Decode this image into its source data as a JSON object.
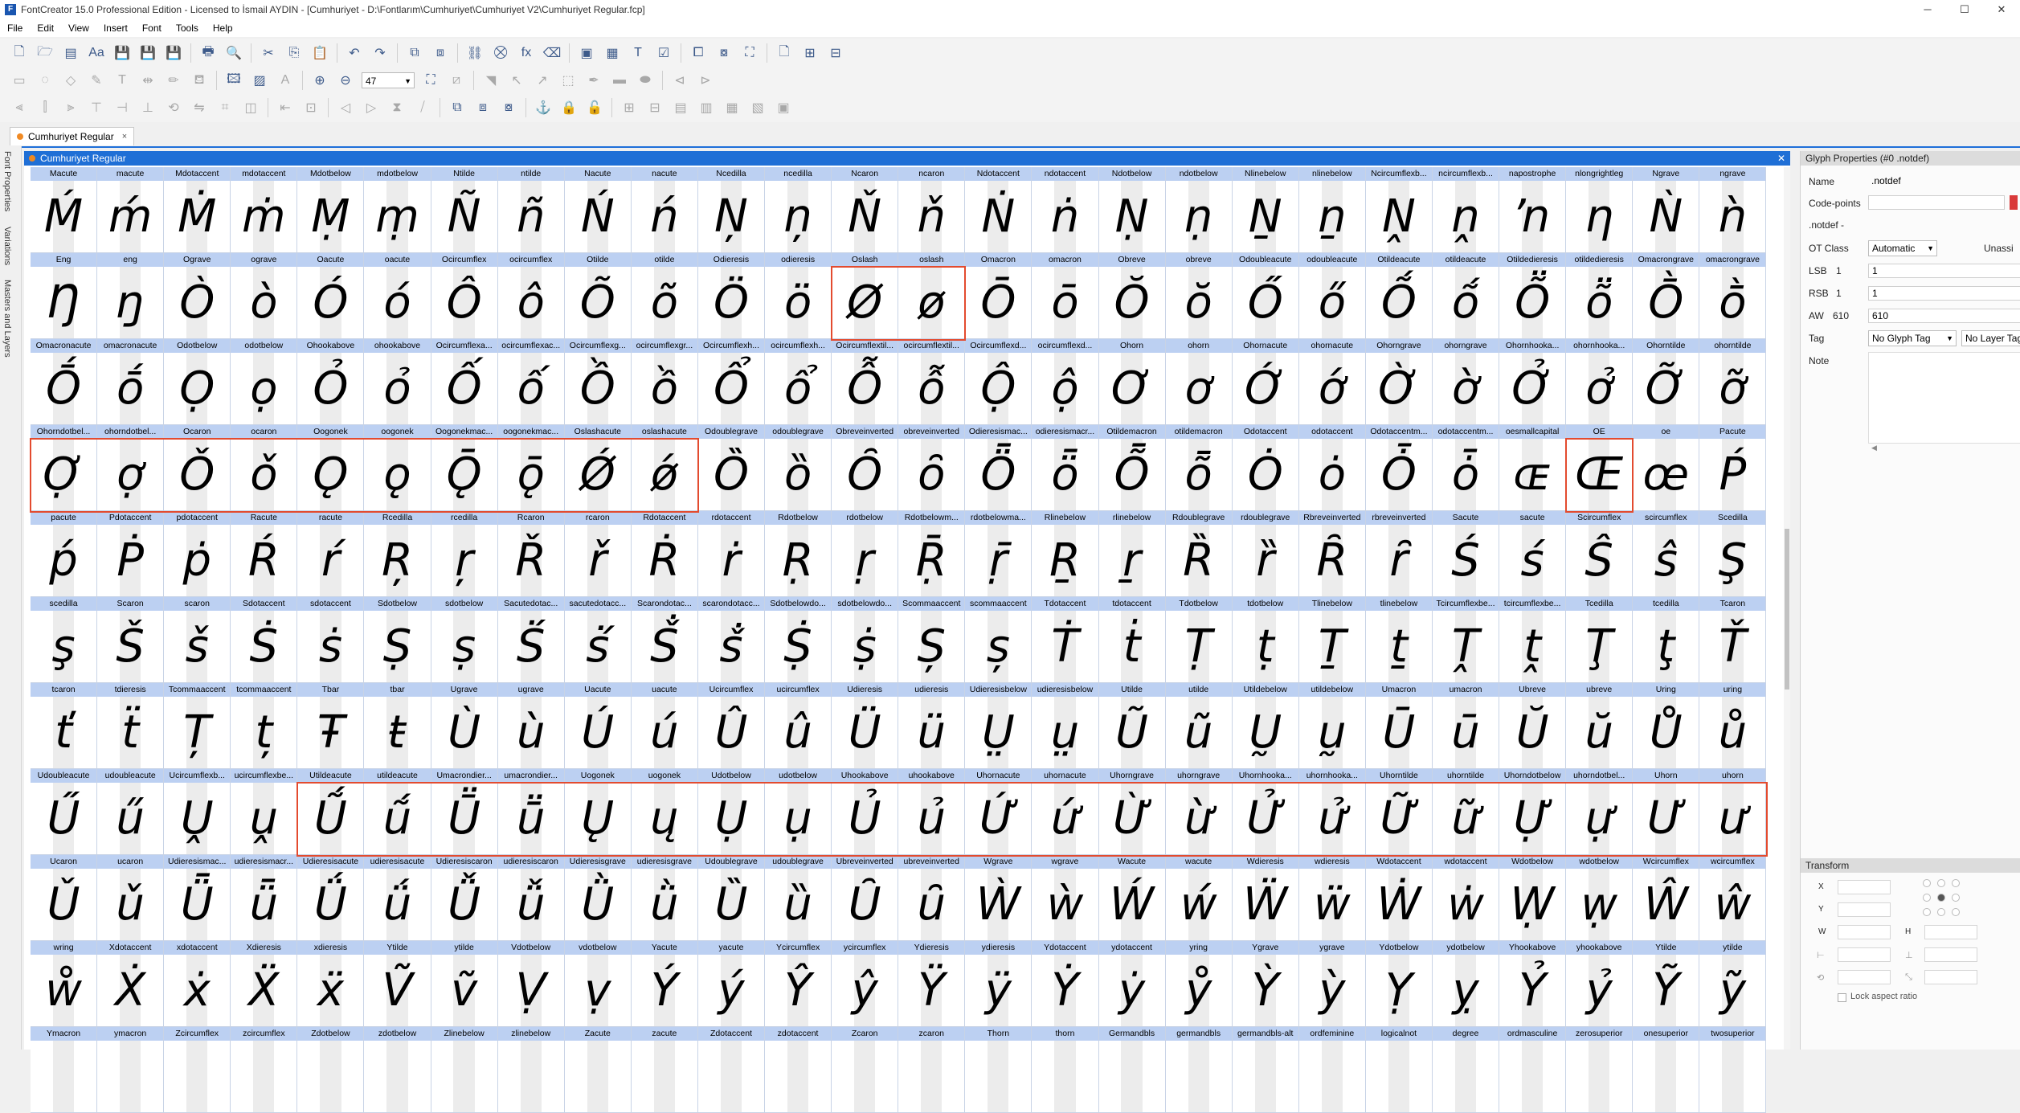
{
  "window": {
    "title": "FontCreator 15.0 Professional Edition - Licensed to İsmail AYDIN - [Cumhuriyet - D:\\Fontlarım\\Cumhuriyet\\Cumhuriyet V2\\Cumhuriyet Regular.fcp]",
    "app_icon_letter": "F",
    "minimize": "─",
    "maximize": "☐",
    "close": "✕"
  },
  "menu": [
    "File",
    "Edit",
    "View",
    "Insert",
    "Font",
    "Tools",
    "Help"
  ],
  "toolbar": {
    "zoom_value": "47"
  },
  "tab": {
    "label": "Cumhuriyet Regular",
    "close": "×"
  },
  "sidebar_tabs": [
    "Font Properties",
    "Variations",
    "Masters and Layers"
  ],
  "font_window": {
    "title": "Cumhuriyet Regular",
    "close": "✕"
  },
  "glyph_rows": [
    [
      [
        "Macute",
        "Ḿ"
      ],
      [
        "macute",
        "ḿ"
      ],
      [
        "Mdotaccent",
        "Ṁ"
      ],
      [
        "mdotaccent",
        "ṁ"
      ],
      [
        "Mdotbelow",
        "Ṃ"
      ],
      [
        "mdotbelow",
        "ṃ"
      ],
      [
        "Ntilde",
        "Ñ"
      ],
      [
        "ntilde",
        "ñ"
      ],
      [
        "Nacute",
        "Ń"
      ],
      [
        "nacute",
        "ń"
      ],
      [
        "Ncedilla",
        "Ņ"
      ],
      [
        "ncedilla",
        "ņ"
      ],
      [
        "Ncaron",
        "Ň"
      ],
      [
        "ncaron",
        "ň"
      ],
      [
        "Ndotaccent",
        "Ṅ"
      ],
      [
        "ndotaccent",
        "ṅ"
      ],
      [
        "Ndotbelow",
        "Ṇ"
      ],
      [
        "ndotbelow",
        "ṇ"
      ],
      [
        "Nlinebelow",
        "Ṉ"
      ],
      [
        "nlinebelow",
        "ṉ"
      ],
      [
        "Ncircumflexb...",
        "Ṋ"
      ],
      [
        "ncircumflexb...",
        "ṋ"
      ],
      [
        "napostrophe",
        "ŉ"
      ],
      [
        "nlongrightleg",
        "ƞ"
      ],
      [
        "Ngrave",
        "Ǹ"
      ],
      [
        "ngrave",
        "ǹ"
      ]
    ],
    [
      [
        "Eng",
        "Ŋ"
      ],
      [
        "eng",
        "ŋ"
      ],
      [
        "Ograve",
        "Ò"
      ],
      [
        "ograve",
        "ò"
      ],
      [
        "Oacute",
        "Ó"
      ],
      [
        "oacute",
        "ó"
      ],
      [
        "Ocircumflex",
        "Ô"
      ],
      [
        "ocircumflex",
        "ô"
      ],
      [
        "Otilde",
        "Õ"
      ],
      [
        "otilde",
        "õ"
      ],
      [
        "Odieresis",
        "Ö"
      ],
      [
        "odieresis",
        "ö"
      ],
      [
        "Oslash",
        "Ø"
      ],
      [
        "oslash",
        "ø"
      ],
      [
        "Omacron",
        "Ō"
      ],
      [
        "omacron",
        "ō"
      ],
      [
        "Obreve",
        "Ŏ"
      ],
      [
        "obreve",
        "ŏ"
      ],
      [
        "Odoubleacute",
        "Ő"
      ],
      [
        "odoubleacute",
        "ő"
      ],
      [
        "Otildeacute",
        "Ṍ"
      ],
      [
        "otildeacute",
        "ṍ"
      ],
      [
        "Otildedieresis",
        "Ṏ"
      ],
      [
        "otildedieresis",
        "ṏ"
      ],
      [
        "Omacrongrave",
        "Ṑ"
      ],
      [
        "omacrongrave",
        "ṑ"
      ]
    ],
    [
      [
        "Omacronacute",
        "Ṓ"
      ],
      [
        "omacronacute",
        "ṓ"
      ],
      [
        "Odotbelow",
        "Ọ"
      ],
      [
        "odotbelow",
        "ọ"
      ],
      [
        "Ohookabove",
        "Ỏ"
      ],
      [
        "ohookabove",
        "ỏ"
      ],
      [
        "Ocircumflexa...",
        "Ố"
      ],
      [
        "ocircumflexac...",
        "ố"
      ],
      [
        "Ocircumflexg...",
        "Ồ"
      ],
      [
        "ocircumflexgr...",
        "ồ"
      ],
      [
        "Ocircumflexh...",
        "Ổ"
      ],
      [
        "ocircumflexh...",
        "ổ"
      ],
      [
        "Ocircumflextil...",
        "Ỗ"
      ],
      [
        "ocircumflextil...",
        "ỗ"
      ],
      [
        "Ocircumflexd...",
        "Ộ"
      ],
      [
        "ocircumflexd...",
        "ộ"
      ],
      [
        "Ohorn",
        "Ơ"
      ],
      [
        "ohorn",
        "ơ"
      ],
      [
        "Ohornacute",
        "Ớ"
      ],
      [
        "ohornacute",
        "ớ"
      ],
      [
        "Ohorngrave",
        "Ờ"
      ],
      [
        "ohorngrave",
        "ờ"
      ],
      [
        "Ohornhooka...",
        "Ở"
      ],
      [
        "ohornhooka...",
        "ở"
      ],
      [
        "Ohorntilde",
        "Ỡ"
      ],
      [
        "ohorntilde",
        "ỡ"
      ]
    ],
    [
      [
        "Ohorndotbel...",
        "Ợ"
      ],
      [
        "ohorndotbel...",
        "ợ"
      ],
      [
        "Ocaron",
        "Ǒ"
      ],
      [
        "ocaron",
        "ǒ"
      ],
      [
        "Oogonek",
        "Ǫ"
      ],
      [
        "oogonek",
        "ǫ"
      ],
      [
        "Oogonekmac...",
        "Ǭ"
      ],
      [
        "oogonekmac...",
        "ǭ"
      ],
      [
        "Oslashacute",
        "Ǿ"
      ],
      [
        "oslashacute",
        "ǿ"
      ],
      [
        "Odoublegrave",
        "Ȍ"
      ],
      [
        "odoublegrave",
        "ȍ"
      ],
      [
        "Obreveinverted",
        "Ȏ"
      ],
      [
        "obreveinverted",
        "ȏ"
      ],
      [
        "Odieresismac...",
        "Ȫ"
      ],
      [
        "odieresismacr...",
        "ȫ"
      ],
      [
        "Otildemacron",
        "Ȭ"
      ],
      [
        "otildemacron",
        "ȭ"
      ],
      [
        "Odotaccent",
        "Ȯ"
      ],
      [
        "odotaccent",
        "ȯ"
      ],
      [
        "Odotaccentm...",
        "Ȱ"
      ],
      [
        "odotaccentm...",
        "ȱ"
      ],
      [
        "oesmallcapital",
        "ɶ"
      ],
      [
        "OE",
        "Œ"
      ],
      [
        "oe",
        "œ"
      ],
      [
        "Pacute",
        "Ṕ"
      ]
    ],
    [
      [
        "pacute",
        "ṕ"
      ],
      [
        "Pdotaccent",
        "Ṗ"
      ],
      [
        "pdotaccent",
        "ṗ"
      ],
      [
        "Racute",
        "Ŕ"
      ],
      [
        "racute",
        "ŕ"
      ],
      [
        "Rcedilla",
        "Ŗ"
      ],
      [
        "rcedilla",
        "ŗ"
      ],
      [
        "Rcaron",
        "Ř"
      ],
      [
        "rcaron",
        "ř"
      ],
      [
        "Rdotaccent",
        "Ṙ"
      ],
      [
        "rdotaccent",
        "ṙ"
      ],
      [
        "Rdotbelow",
        "Ṛ"
      ],
      [
        "rdotbelow",
        "ṛ"
      ],
      [
        "Rdotbelowm...",
        "Ṝ"
      ],
      [
        "rdotbelowma...",
        "ṝ"
      ],
      [
        "Rlinebelow",
        "Ṟ"
      ],
      [
        "rlinebelow",
        "ṟ"
      ],
      [
        "Rdoublegrave",
        "Ȑ"
      ],
      [
        "rdoublegrave",
        "ȑ"
      ],
      [
        "Rbreveinverted",
        "Ȓ"
      ],
      [
        "rbreveinverted",
        "ȓ"
      ],
      [
        "Sacute",
        "Ś"
      ],
      [
        "sacute",
        "ś"
      ],
      [
        "Scircumflex",
        "Ŝ"
      ],
      [
        "scircumflex",
        "ŝ"
      ],
      [
        "Scedilla",
        "Ş"
      ]
    ],
    [
      [
        "scedilla",
        "ş"
      ],
      [
        "Scaron",
        "Š"
      ],
      [
        "scaron",
        "š"
      ],
      [
        "Sdotaccent",
        "Ṡ"
      ],
      [
        "sdotaccent",
        "ṡ"
      ],
      [
        "Sdotbelow",
        "Ṣ"
      ],
      [
        "sdotbelow",
        "ṣ"
      ],
      [
        "Sacutedotac...",
        "Ṥ"
      ],
      [
        "sacutedotacc...",
        "ṥ"
      ],
      [
        "Scarondotac...",
        "Ṧ"
      ],
      [
        "scarondotacc...",
        "ṧ"
      ],
      [
        "Sdotbelowdo...",
        "Ṩ"
      ],
      [
        "sdotbelowdo...",
        "ṩ"
      ],
      [
        "Scommaaccent",
        "Ș"
      ],
      [
        "scommaaccent",
        "ș"
      ],
      [
        "Tdotaccent",
        "Ṫ"
      ],
      [
        "tdotaccent",
        "ṫ"
      ],
      [
        "Tdotbelow",
        "Ṭ"
      ],
      [
        "tdotbelow",
        "ṭ"
      ],
      [
        "Tlinebelow",
        "Ṯ"
      ],
      [
        "tlinebelow",
        "ṯ"
      ],
      [
        "Tcircumflexbe...",
        "Ṱ"
      ],
      [
        "tcircumflexbe...",
        "ṱ"
      ],
      [
        "Tcedilla",
        "Ţ"
      ],
      [
        "tcedilla",
        "ţ"
      ],
      [
        "Tcaron",
        "Ť"
      ]
    ],
    [
      [
        "tcaron",
        "ť"
      ],
      [
        "tdieresis",
        "ẗ"
      ],
      [
        "Tcommaaccent",
        "Ț"
      ],
      [
        "tcommaaccent",
        "ț"
      ],
      [
        "Tbar",
        "Ŧ"
      ],
      [
        "tbar",
        "ŧ"
      ],
      [
        "Ugrave",
        "Ù"
      ],
      [
        "ugrave",
        "ù"
      ],
      [
        "Uacute",
        "Ú"
      ],
      [
        "uacute",
        "ú"
      ],
      [
        "Ucircumflex",
        "Û"
      ],
      [
        "ucircumflex",
        "û"
      ],
      [
        "Udieresis",
        "Ü"
      ],
      [
        "udieresis",
        "ü"
      ],
      [
        "Udieresisbelow",
        "Ṳ"
      ],
      [
        "udieresisbelow",
        "ṳ"
      ],
      [
        "Utilde",
        "Ũ"
      ],
      [
        "utilde",
        "ũ"
      ],
      [
        "Utildebelow",
        "Ṵ"
      ],
      [
        "utildebelow",
        "ṵ"
      ],
      [
        "Umacron",
        "Ū"
      ],
      [
        "umacron",
        "ū"
      ],
      [
        "Ubreve",
        "Ŭ"
      ],
      [
        "ubreve",
        "ŭ"
      ],
      [
        "Uring",
        "Ů"
      ],
      [
        "uring",
        "ů"
      ]
    ],
    [
      [
        "Udoubleacute",
        "Ű"
      ],
      [
        "udoubleacute",
        "ű"
      ],
      [
        "Ucircumflexb...",
        "Ṷ"
      ],
      [
        "ucircumflexbe...",
        "ṷ"
      ],
      [
        "Utildeacute",
        "Ṹ"
      ],
      [
        "utildeacute",
        "ṹ"
      ],
      [
        "Umacrondier...",
        "Ṻ"
      ],
      [
        "umacrondier...",
        "ṻ"
      ],
      [
        "Uogonek",
        "Ų"
      ],
      [
        "uogonek",
        "ų"
      ],
      [
        "Udotbelow",
        "Ụ"
      ],
      [
        "udotbelow",
        "ụ"
      ],
      [
        "Uhookabove",
        "Ủ"
      ],
      [
        "uhookabove",
        "ủ"
      ],
      [
        "Uhornacute",
        "Ứ"
      ],
      [
        "uhornacute",
        "ứ"
      ],
      [
        "Uhorngrave",
        "Ừ"
      ],
      [
        "uhorngrave",
        "ừ"
      ],
      [
        "Uhornhooka...",
        "Ử"
      ],
      [
        "uhornhooka...",
        "ử"
      ],
      [
        "Uhorntilde",
        "Ữ"
      ],
      [
        "uhorntilde",
        "ữ"
      ],
      [
        "Uhorndotbelow",
        "Ự"
      ],
      [
        "uhorndotbel...",
        "ự"
      ],
      [
        "Uhorn",
        "Ư"
      ],
      [
        "uhorn",
        "ư"
      ]
    ],
    [
      [
        "Ucaron",
        "Ǔ"
      ],
      [
        "ucaron",
        "ǔ"
      ],
      [
        "Udieresismac...",
        "Ǖ"
      ],
      [
        "udieresismacr...",
        "ǖ"
      ],
      [
        "Udieresisacute",
        "Ǘ"
      ],
      [
        "udieresisacute",
        "ǘ"
      ],
      [
        "Udieresiscaron",
        "Ǚ"
      ],
      [
        "udieresiscaron",
        "ǚ"
      ],
      [
        "Udieresisgrave",
        "Ǜ"
      ],
      [
        "udieresisgrave",
        "ǜ"
      ],
      [
        "Udoublegrave",
        "Ȕ"
      ],
      [
        "udoublegrave",
        "ȕ"
      ],
      [
        "Ubreveinverted",
        "Ȗ"
      ],
      [
        "ubreveinverted",
        "ȗ"
      ],
      [
        "Wgrave",
        "Ẁ"
      ],
      [
        "wgrave",
        "ẁ"
      ],
      [
        "Wacute",
        "Ẃ"
      ],
      [
        "wacute",
        "ẃ"
      ],
      [
        "Wdieresis",
        "Ẅ"
      ],
      [
        "wdieresis",
        "ẅ"
      ],
      [
        "Wdotaccent",
        "Ẇ"
      ],
      [
        "wdotaccent",
        "ẇ"
      ],
      [
        "Wdotbelow",
        "Ẉ"
      ],
      [
        "wdotbelow",
        "ẉ"
      ],
      [
        "Wcircumflex",
        "Ŵ"
      ],
      [
        "wcircumflex",
        "ŵ"
      ]
    ],
    [
      [
        "wring",
        "ẘ"
      ],
      [
        "Xdotaccent",
        "Ẋ"
      ],
      [
        "xdotaccent",
        "ẋ"
      ],
      [
        "Xdieresis",
        "Ẍ"
      ],
      [
        "xdieresis",
        "ẍ"
      ],
      [
        "Ytilde",
        "Ṽ"
      ],
      [
        "ytilde",
        "ṽ"
      ],
      [
        "Vdotbelow",
        "Ṿ"
      ],
      [
        "vdotbelow",
        "ṿ"
      ],
      [
        "Yacute",
        "Ý"
      ],
      [
        "yacute",
        "ý"
      ],
      [
        "Ycircumflex",
        "Ŷ"
      ],
      [
        "ycircumflex",
        "ŷ"
      ],
      [
        "Ydieresis",
        "Ÿ"
      ],
      [
        "ydieresis",
        "ÿ"
      ],
      [
        "Ydotaccent",
        "Ẏ"
      ],
      [
        "ydotaccent",
        "ẏ"
      ],
      [
        "yring",
        "ẙ"
      ],
      [
        "Ygrave",
        "Ỳ"
      ],
      [
        "ygrave",
        "ỳ"
      ],
      [
        "Ydotbelow",
        "Ỵ"
      ],
      [
        "ydotbelow",
        "ỵ"
      ],
      [
        "Yhookabove",
        "Ỷ"
      ],
      [
        "yhookabove",
        "ỷ"
      ],
      [
        "Ytilde",
        "Ỹ"
      ],
      [
        "ytilde",
        "ỹ"
      ]
    ],
    [
      [
        "Ymacron",
        ""
      ],
      [
        "ymacron",
        ""
      ],
      [
        "Zcircumflex",
        ""
      ],
      [
        "zcircumflex",
        ""
      ],
      [
        "Zdotbelow",
        ""
      ],
      [
        "zdotbelow",
        ""
      ],
      [
        "Zlinebelow",
        ""
      ],
      [
        "zlinebelow",
        ""
      ],
      [
        "Zacute",
        ""
      ],
      [
        "zacute",
        ""
      ],
      [
        "Zdotaccent",
        ""
      ],
      [
        "zdotaccent",
        ""
      ],
      [
        "Zcaron",
        ""
      ],
      [
        "zcaron",
        ""
      ],
      [
        "Thorn",
        ""
      ],
      [
        "thorn",
        ""
      ],
      [
        "Germandbls",
        ""
      ],
      [
        "germandbls",
        ""
      ],
      [
        "germandbls-alt",
        ""
      ],
      [
        "ordfeminine",
        ""
      ],
      [
        "logicalnot",
        ""
      ],
      [
        "degree",
        ""
      ],
      [
        "ordmasculine",
        ""
      ],
      [
        "zerosuperior",
        ""
      ],
      [
        "onesuperior",
        ""
      ],
      [
        "twosuperior",
        ""
      ]
    ]
  ],
  "glyph_properties": {
    "title": "Glyph Properties (#0 .notdef)",
    "name_label": "Name",
    "name_value": ".notdef",
    "codepoints_label": "Code-points",
    "notdef_label": ".notdef -",
    "otclass_label": "OT Class",
    "otclass_value": "Automatic",
    "otclass_extra": "Unassi",
    "lsb_label": "LSB",
    "lsb_num": "1",
    "lsb_value": "1",
    "rsb_label": "RSB",
    "rsb_num": "1",
    "rsb_value": "1",
    "aw_label": "AW",
    "aw_num": "610",
    "aw_value": "610",
    "tag_label": "Tag",
    "tag_value": "No Glyph Tag",
    "tag_layer_value": "No Layer Tag",
    "note_label": "Note"
  },
  "transform": {
    "title": "Transform",
    "x_label": "X",
    "y_label": "Y",
    "w_label": "W",
    "h_label": "H",
    "lock_label": "Lock aspect ratio"
  }
}
